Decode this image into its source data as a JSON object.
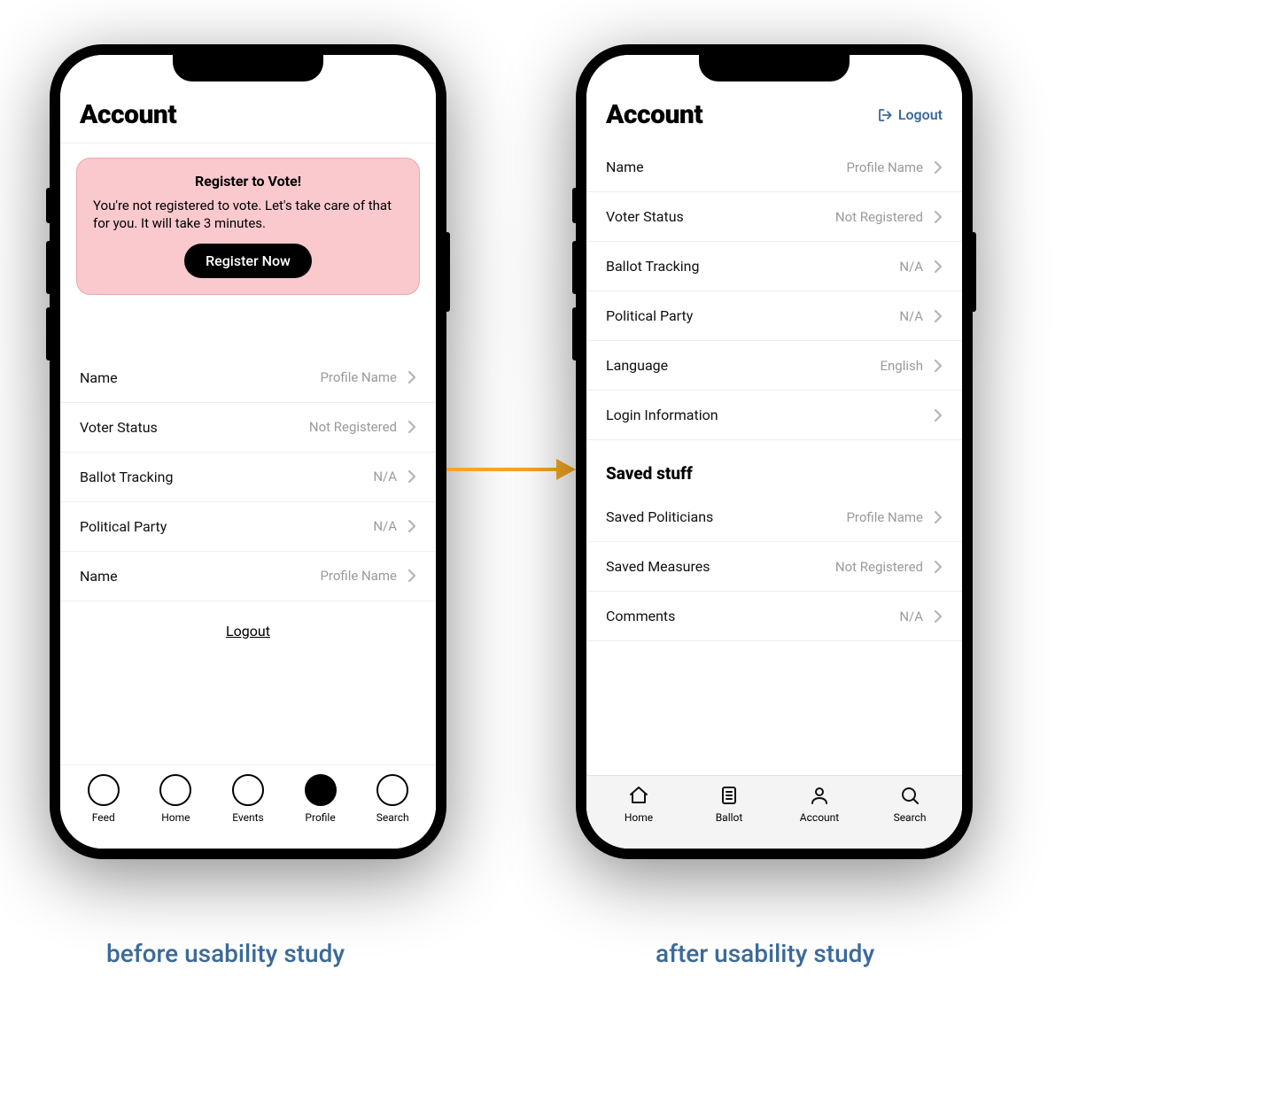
{
  "captions": {
    "before": "before usability study",
    "after": "after usability study"
  },
  "before": {
    "title": "Account",
    "banner": {
      "title": "Register to Vote!",
      "body": "You're not registered to vote. Let's take care of that for you. It will take 3 minutes.",
      "button": "Register Now"
    },
    "rows": [
      {
        "label": "Name",
        "value": "Profile Name"
      },
      {
        "label": "Voter Status",
        "value": "Not Registered"
      },
      {
        "label": "Ballot Tracking",
        "value": "N/A"
      },
      {
        "label": "Political Party",
        "value": "N/A"
      },
      {
        "label": "Name",
        "value": "Profile Name"
      }
    ],
    "logout": "Logout",
    "tabs": [
      {
        "label": "Feed"
      },
      {
        "label": "Home"
      },
      {
        "label": "Events"
      },
      {
        "label": "Profile"
      },
      {
        "label": "Search"
      }
    ]
  },
  "after": {
    "title": "Account",
    "logout": "Logout",
    "rows": [
      {
        "label": "Name",
        "value": "Profile Name"
      },
      {
        "label": "Voter Status",
        "value": "Not Registered"
      },
      {
        "label": "Ballot Tracking",
        "value": "N/A"
      },
      {
        "label": "Political Party",
        "value": "N/A"
      },
      {
        "label": "Language",
        "value": "English"
      },
      {
        "label": "Login Information",
        "value": ""
      }
    ],
    "section": "Saved stuff",
    "saved_rows": [
      {
        "label": "Saved Politicians",
        "value": "Profile Name"
      },
      {
        "label": "Saved Measures",
        "value": "Not Registered"
      },
      {
        "label": "Comments",
        "value": "N/A"
      }
    ],
    "tabs": [
      {
        "label": "Home"
      },
      {
        "label": "Ballot"
      },
      {
        "label": "Account"
      },
      {
        "label": "Search"
      }
    ]
  }
}
